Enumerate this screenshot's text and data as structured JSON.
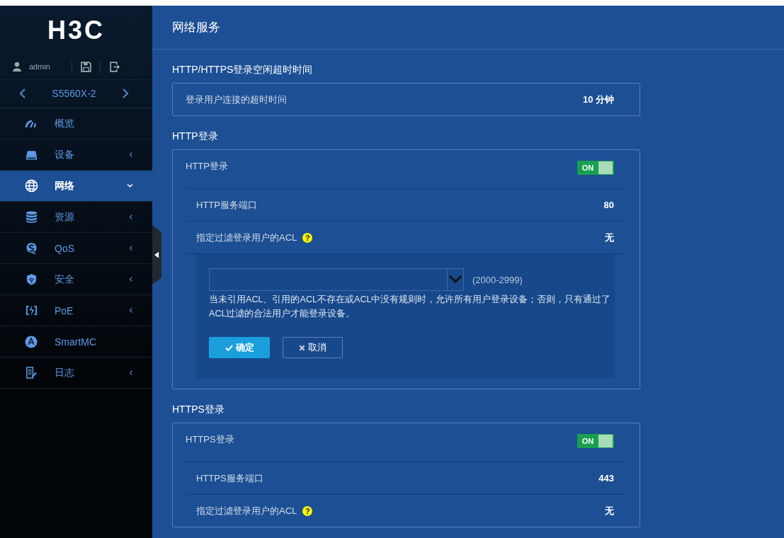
{
  "logo": "H3C",
  "user": {
    "name": "admin"
  },
  "device": {
    "name": "S5560X-2"
  },
  "nav": [
    {
      "label": "概览",
      "expandable": false,
      "selected": false
    },
    {
      "label": "设备",
      "expandable": true,
      "expanded": false,
      "selected": false
    },
    {
      "label": "网络",
      "expandable": true,
      "expanded": true,
      "selected": true
    },
    {
      "label": "资源",
      "expandable": true,
      "expanded": false,
      "selected": false
    },
    {
      "label": "QoS",
      "expandable": true,
      "expanded": false,
      "selected": false
    },
    {
      "label": "安全",
      "expandable": true,
      "expanded": false,
      "selected": false
    },
    {
      "label": "PoE",
      "expandable": true,
      "expanded": false,
      "selected": false
    },
    {
      "label": "SmartMC",
      "expandable": false,
      "selected": false
    },
    {
      "label": "日志",
      "expandable": true,
      "expanded": false,
      "selected": false
    }
  ],
  "page_title": "网络服务",
  "timeout_section": {
    "heading": "HTTP/HTTPS登录空闲超时时间",
    "label": "登录用户连接的超时时间",
    "value": "10 分钟"
  },
  "sections": [
    {
      "heading": "HTTP登录",
      "toggle_label": "HTTP登录",
      "toggle_text": "ON",
      "on": true,
      "rows": [
        {
          "label": "HTTP服务端口",
          "value": "80"
        },
        {
          "label": "指定过滤登录用户的ACL",
          "help": "?",
          "value": "无"
        }
      ],
      "editor": {
        "range": "(2000-2999)",
        "note": "当未引用ACL、引用的ACL不存在或ACL中没有规则时，允许所有用户登录设备；否则，只有通过了ACL过滤的合法用户才能登录设备。",
        "ok": "确定",
        "cancel": "取消"
      }
    },
    {
      "heading": "HTTPS登录",
      "toggle_label": "HTTPS登录",
      "toggle_text": "ON",
      "on": true,
      "rows": [
        {
          "label": "HTTPS服务端口",
          "value": "443"
        },
        {
          "label": "指定过滤登录用户的ACL",
          "help": "?",
          "value": "无"
        }
      ]
    }
  ]
}
